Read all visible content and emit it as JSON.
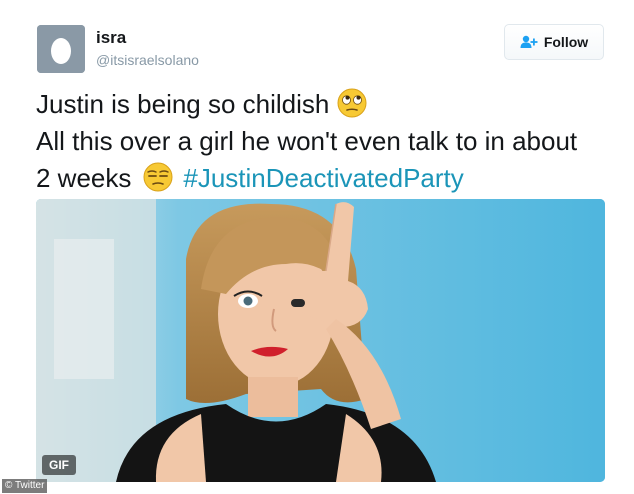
{
  "user": {
    "display_name": "isra",
    "handle": "@itsisraelsolano",
    "avatar_icon": "egg-avatar-icon"
  },
  "follow_button": {
    "label": "Follow",
    "icon": "add-user-icon"
  },
  "tweet": {
    "line1": "Justin is being so childish",
    "line1_emoji": "eye-roll-emoji-icon",
    "line2": "All this over a girl he won't even talk to in about",
    "line3": "2 weeks",
    "line3_emoji": "unamused-emoji-icon",
    "hashtag": "#JustinDeactivatedParty"
  },
  "media": {
    "badge": "GIF"
  },
  "credit": "© Twitter",
  "colors": {
    "hashtag": "#1b95b8",
    "handle": "#8899a6",
    "text": "#14171a",
    "follow_icon": "#1da1f2",
    "media_bg": "#58b8dc"
  }
}
